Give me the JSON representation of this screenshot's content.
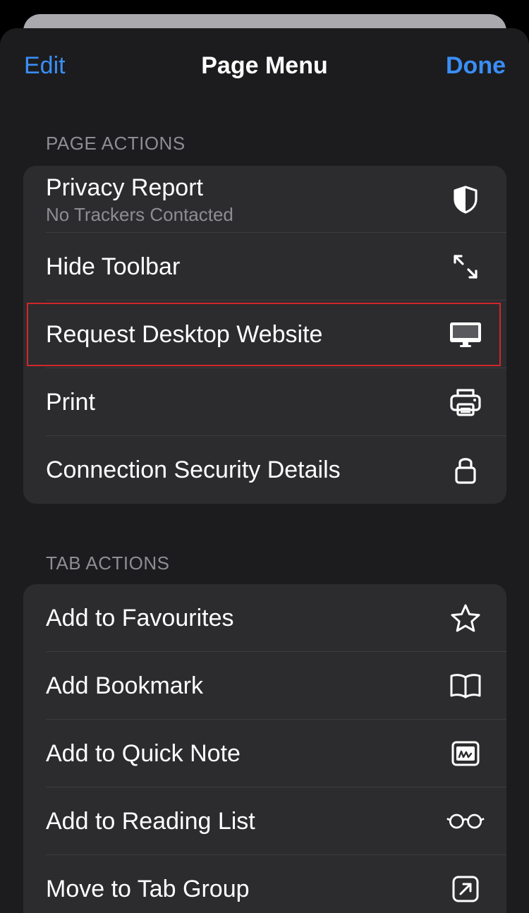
{
  "nav": {
    "edit_label": "Edit",
    "title": "Page Menu",
    "done_label": "Done"
  },
  "page_actions": {
    "header": "PAGE ACTIONS",
    "items": [
      {
        "label": "Privacy Report",
        "subtitle": "No Trackers Contacted",
        "icon": "shield-icon"
      },
      {
        "label": "Hide Toolbar",
        "icon": "expand-arrows-icon"
      },
      {
        "label": "Request Desktop Website",
        "icon": "desktop-computer-icon",
        "highlighted": true
      },
      {
        "label": "Print",
        "icon": "printer-icon"
      },
      {
        "label": "Connection Security Details",
        "icon": "lock-icon"
      }
    ]
  },
  "tab_actions": {
    "header": "TAB ACTIONS",
    "items": [
      {
        "label": "Add to Favourites",
        "icon": "star-icon"
      },
      {
        "label": "Add Bookmark",
        "icon": "book-icon"
      },
      {
        "label": "Add to Quick Note",
        "icon": "quick-note-icon"
      },
      {
        "label": "Add to Reading List",
        "icon": "glasses-icon"
      },
      {
        "label": "Move to Tab Group",
        "icon": "arrow-square-icon"
      }
    ]
  },
  "colors": {
    "accent": "#3a8ef6",
    "sheet_background": "#1c1c1e",
    "group_background": "#2c2c2e",
    "secondary_text": "#8d8d93",
    "highlight_border": "#d0262d"
  }
}
